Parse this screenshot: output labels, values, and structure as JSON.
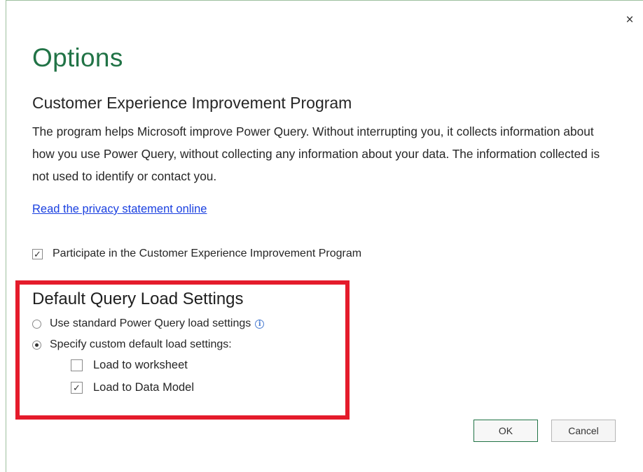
{
  "dialog": {
    "close_symbol": "×",
    "title": "Options"
  },
  "ceip": {
    "heading": "Customer Experience Improvement Program",
    "description": "The program helps Microsoft improve Power Query. Without interrupting you, it collects information about how you use Power Query, without collecting any information about your data. The information collected is not used to identify or contact you.",
    "privacy_link": "Read the privacy statement online",
    "participate_label": "Participate in the Customer Experience Improvement Program",
    "participate_checked": true
  },
  "load_settings": {
    "heading": "Default Query Load Settings",
    "option_standard": "Use standard Power Query load settings",
    "option_custom": "Specify custom default load settings:",
    "selected": "custom",
    "load_to_worksheet": "Load to worksheet",
    "load_to_worksheet_checked": false,
    "load_to_data_model": "Load to Data Model",
    "load_to_data_model_checked": true,
    "highlight_color": "#e41b2b"
  },
  "buttons": {
    "ok": "OK",
    "cancel": "Cancel"
  },
  "colors": {
    "title": "#217346",
    "link": "#1a40e0"
  }
}
